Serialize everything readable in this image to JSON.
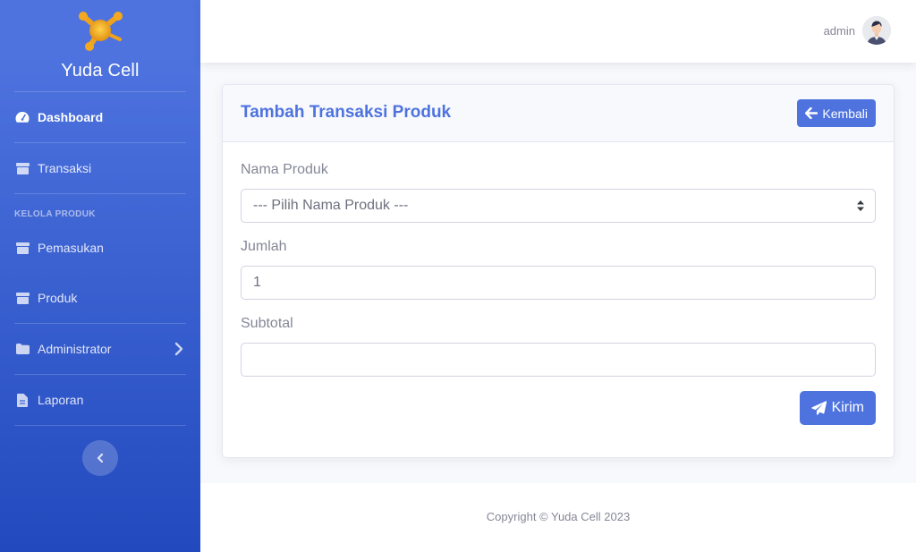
{
  "brand": {
    "name": "Yuda Cell",
    "logo_icon": "molecule-logo"
  },
  "sidebar": {
    "items": [
      {
        "label": "Dashboard",
        "icon": "tachometer-icon",
        "active": true
      },
      {
        "label": "Transaksi",
        "icon": "box-icon"
      },
      {
        "label": "Pemasukan",
        "icon": "box-icon"
      },
      {
        "label": "Produk",
        "icon": "box-icon"
      },
      {
        "label": "Administrator",
        "icon": "folder-icon"
      },
      {
        "label": "Laporan",
        "icon": "file-icon"
      }
    ],
    "heading": "KELOLA PRODUK"
  },
  "topbar": {
    "user_name": "admin"
  },
  "card": {
    "title": "Tambah Transaksi Produk",
    "back_label": "Kembali",
    "fields": {
      "product_label": "Nama Produk",
      "product_value": "--- Pilih Nama Produk ---",
      "qty_label": "Jumlah",
      "qty_value": "1",
      "subtotal_label": "Subtotal",
      "subtotal_value": ""
    },
    "submit_label": "Kirim"
  },
  "footer": {
    "copyright": "Copyright © Yuda Cell 2023"
  },
  "colors": {
    "primary": "#4e73df",
    "primary_dark": "#224abe",
    "text_muted": "#858796"
  }
}
